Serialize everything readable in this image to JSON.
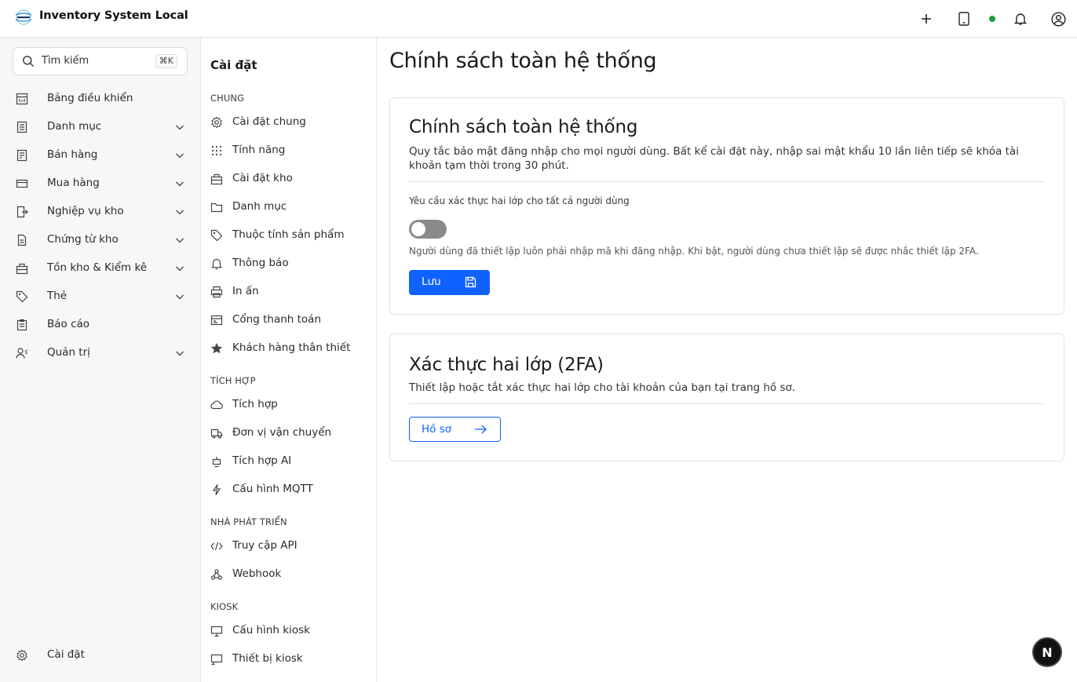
{
  "app": {
    "title": "Inventory System Local"
  },
  "topbar": {
    "icons": [
      "plus-icon",
      "tablet-icon",
      "status-online",
      "bell-icon",
      "user-circle-icon"
    ]
  },
  "sidebar": {
    "search": {
      "placeholder": "Tìm kiếm",
      "shortcut": "⌘K"
    },
    "items": [
      {
        "label": "Bảng điều khiển",
        "icon": "dashboard-icon",
        "expandable": false
      },
      {
        "label": "Danh mục",
        "icon": "catalog-icon",
        "expandable": true
      },
      {
        "label": "Bán hàng",
        "icon": "sales-icon",
        "expandable": true
      },
      {
        "label": "Mua hàng",
        "icon": "purchase-icon",
        "expandable": true
      },
      {
        "label": "Nghiệp vụ kho",
        "icon": "warehouse-ops-icon",
        "expandable": true
      },
      {
        "label": "Chứng từ kho",
        "icon": "document-icon",
        "expandable": true
      },
      {
        "label": "Tồn kho & Kiểm kê",
        "icon": "inventory-icon",
        "expandable": true
      },
      {
        "label": "Thẻ",
        "icon": "tag-icon",
        "expandable": true
      },
      {
        "label": "Báo cáo",
        "icon": "report-icon",
        "expandable": false
      },
      {
        "label": "Quản trị",
        "icon": "admin-icon",
        "expandable": true
      }
    ],
    "footer": {
      "label": "Cài đặt",
      "icon": "gear-icon"
    }
  },
  "settings_nav": {
    "title": "Cài đặt",
    "sections": [
      {
        "title": "CHUNG",
        "items": [
          {
            "label": "Cài đặt chung",
            "icon": "gear-icon"
          },
          {
            "label": "Tính năng",
            "icon": "grid-icon"
          },
          {
            "label": "Cài đặt kho",
            "icon": "warehouse-icon"
          },
          {
            "label": "Danh mục",
            "icon": "folder-icon"
          },
          {
            "label": "Thuộc tính sản phẩm",
            "icon": "tag-icon"
          },
          {
            "label": "Thông báo",
            "icon": "bell-icon"
          },
          {
            "label": "In ấn",
            "icon": "printer-icon"
          },
          {
            "label": "Cổng thanh toán",
            "icon": "payment-icon"
          },
          {
            "label": "Khách hàng thân thiết",
            "icon": "star-icon"
          }
        ]
      },
      {
        "title": "TÍCH HỢP",
        "items": [
          {
            "label": "Tích hợp",
            "icon": "cloud-icon"
          },
          {
            "label": "Đơn vị vận chuyển",
            "icon": "truck-icon"
          },
          {
            "label": "Tích hợp AI",
            "icon": "robot-icon"
          },
          {
            "label": "Cấu hình MQTT",
            "icon": "lightning-icon"
          }
        ]
      },
      {
        "title": "NHÀ PHÁT TRIỂN",
        "items": [
          {
            "label": "Truy cập API",
            "icon": "code-icon"
          },
          {
            "label": "Webhook",
            "icon": "webhook-icon"
          }
        ]
      },
      {
        "title": "KIOSK",
        "items": [
          {
            "label": "Cấu hình kiosk",
            "icon": "monitor-icon"
          },
          {
            "label": "Thiết bị kiosk",
            "icon": "kiosk-device-icon"
          }
        ]
      }
    ]
  },
  "main": {
    "title": "Chính sách toàn hệ thống",
    "policy_card": {
      "title": "Chính sách toàn hệ thống",
      "description": "Quy tắc bảo mật đăng nhập cho mọi người dùng. Bất kể cài đặt này, nhập sai mật khẩu 10 lần liên tiếp sẽ khóa tài khoản tạm thời trong 30 phút.",
      "field_label": "Yêu cầu xác thực hai lớp cho tất cả người dùng",
      "toggle_on": false,
      "helper": "Người dùng đã thiết lập luôn phải nhập mã khi đăng nhập. Khi bật, người dùng chưa thiết lập sẽ được nhắc thiết lập 2FA.",
      "save_label": "Lưu"
    },
    "twofa_card": {
      "title": "Xác thực hai lớp (2FA)",
      "description": "Thiết lập hoặc tắt xác thực hai lớp cho tài khoản của bạn tại trang hồ sơ.",
      "profile_label": "Hồ sơ"
    }
  },
  "fab": {
    "label": "N"
  },
  "colors": {
    "primary": "#0f62fe",
    "status_online": "#1e9e3c",
    "toggle_off": "#8a8a8a"
  }
}
